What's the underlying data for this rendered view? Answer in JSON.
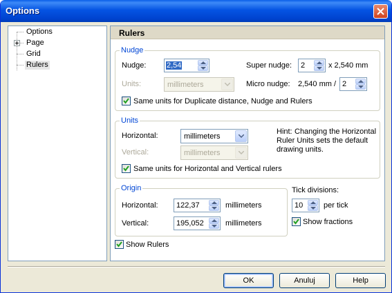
{
  "window": {
    "title": "Options"
  },
  "tree": {
    "items": [
      {
        "label": "Options"
      },
      {
        "label": "Page"
      },
      {
        "label": "Grid"
      },
      {
        "label": "Rulers"
      }
    ]
  },
  "panel": {
    "title": "Rulers"
  },
  "nudge": {
    "legend": "Nudge",
    "nudge_label": "Nudge:",
    "nudge_value": "2,54",
    "units_label": "Units:",
    "units_value": "millimeters",
    "super_label": "Super nudge:",
    "super_value": "2",
    "super_suffix": "x 2,540 mm",
    "micro_label": "Micro nudge:",
    "micro_prefix": "2,540 mm /",
    "micro_value": "2",
    "same_units_label": "Same units for Duplicate distance, Nudge and Rulers",
    "same_units_checked": true
  },
  "units": {
    "legend": "Units",
    "horizontal_label": "Horizontal:",
    "horizontal_value": "millimeters",
    "vertical_label": "Vertical:",
    "vertical_value": "millimeters",
    "hint_label": "Hint:",
    "hint_text": "Changing the Horizontal Ruler Units sets the default drawing units.",
    "same_units_label": "Same units for Horizontal and Vertical rulers",
    "same_units_checked": true
  },
  "origin": {
    "legend": "Origin",
    "horizontal_label": "Horizontal:",
    "horizontal_value": "122,37",
    "horizontal_unit": "millimeters",
    "vertical_label": "Vertical:",
    "vertical_value": "195,052",
    "vertical_unit": "millimeters"
  },
  "tick": {
    "label": "Tick divisions:",
    "value": "10",
    "suffix": "per tick",
    "show_fractions_label": "Show fractions",
    "show_fractions_checked": true
  },
  "show_rulers": {
    "label": "Show Rulers",
    "checked": true
  },
  "buttons": {
    "ok": "OK",
    "cancel": "Anuluj",
    "help": "Help"
  },
  "colors": {
    "titlebar": "#0054e3",
    "legend": "#0046d5",
    "dialog_bg": "#ece9d8"
  }
}
